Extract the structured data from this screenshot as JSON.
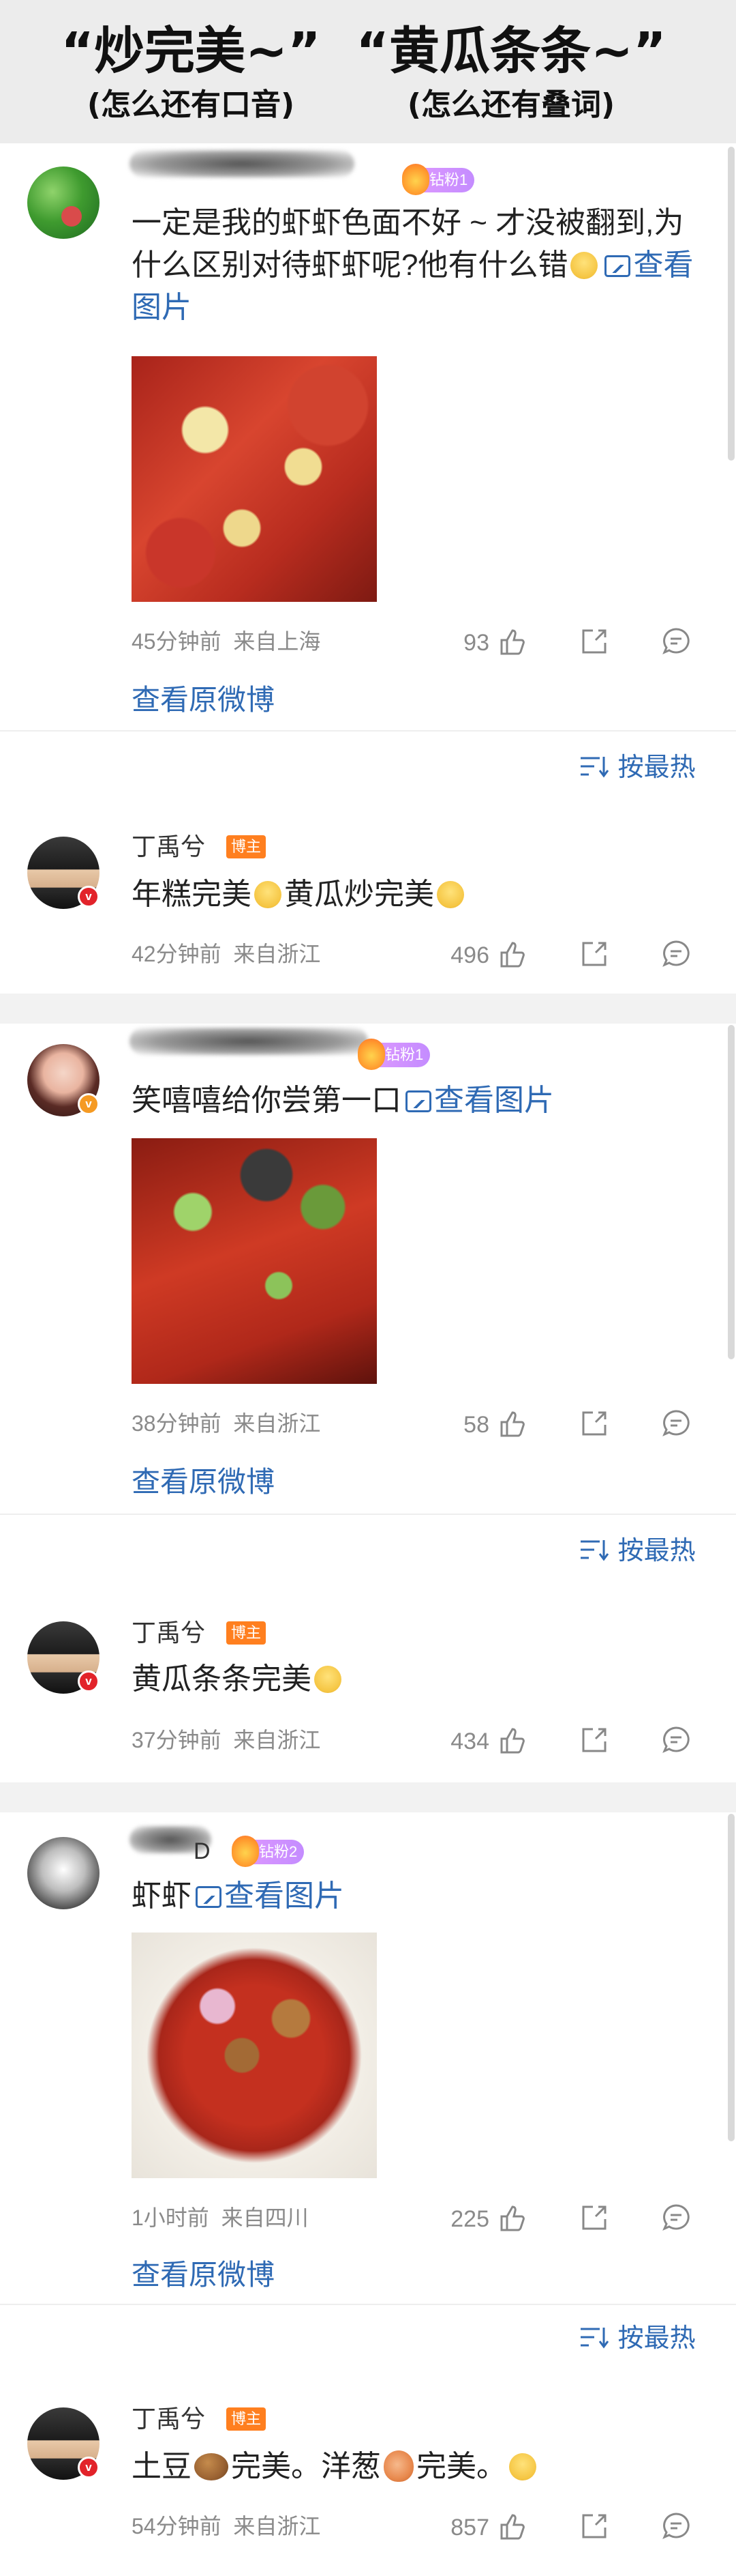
{
  "header": {
    "left_title": "“炒完美~”",
    "left_sub": "(怎么还有口音)",
    "right_title": "“黄瓜条条~”",
    "right_sub": "(怎么还有叠词)"
  },
  "fan_badge_1": "钻粉1",
  "fan_badge_2": "钻粉2",
  "view_image": "查看图片",
  "view_original": "查看原微博",
  "sort_label": "按最热",
  "host_badge": "博主",
  "threads": [
    {
      "fan_comment": {
        "text": "一定是我的虾虾色面不好 ~ 才没被翻到,为什么区别对待虾虾呢?他有什么错",
        "time": "45分钟前",
        "location": "来自上海",
        "likes": "93"
      },
      "reply": {
        "username": "丁禹兮",
        "text_a": "年糕完美",
        "text_b": "黄瓜炒完美",
        "time": "42分钟前",
        "location": "来自浙江",
        "likes": "496"
      }
    },
    {
      "fan_comment": {
        "text": "笑嘻嘻给你尝第一口",
        "time": "38分钟前",
        "location": "来自浙江",
        "likes": "58"
      },
      "reply": {
        "username": "丁禹兮",
        "text_a": "黄瓜条条完美",
        "time": "37分钟前",
        "location": "来自浙江",
        "likes": "434"
      }
    },
    {
      "fan_comment": {
        "text": "虾虾",
        "name_visible": "D",
        "time": "1小时前",
        "location": "来自四川",
        "likes": "225"
      },
      "reply": {
        "username": "丁禹兮",
        "text_a": "土豆",
        "text_b": "完美。洋葱",
        "text_c": "完美。",
        "time": "54分钟前",
        "location": "来自浙江",
        "likes": "857"
      }
    }
  ],
  "icons": [
    "thumb-up-icon",
    "share-icon",
    "comment-icon",
    "image-icon",
    "sort-icon"
  ]
}
